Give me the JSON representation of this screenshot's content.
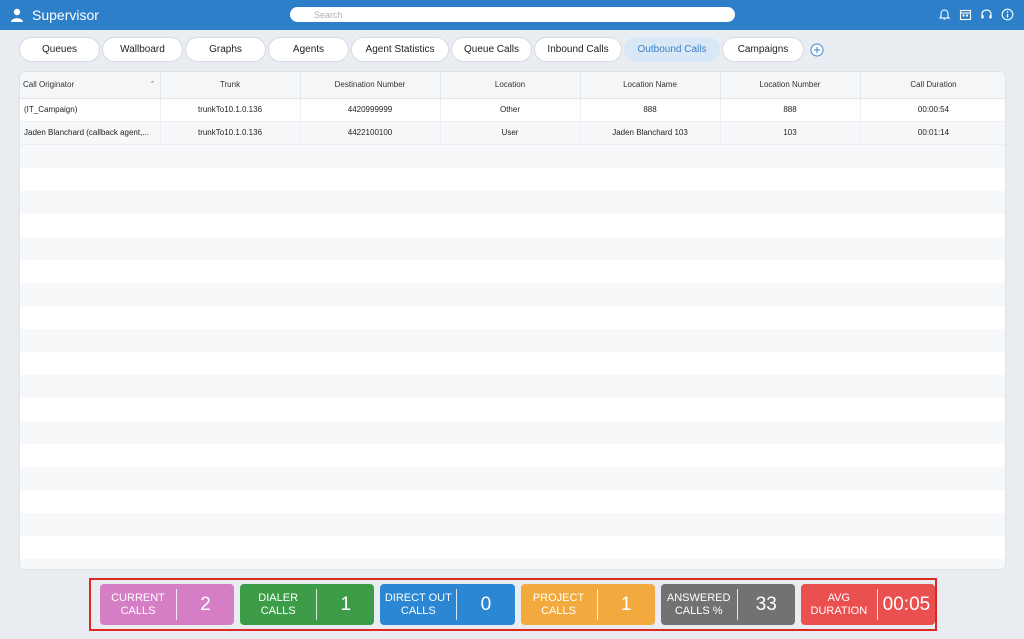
{
  "header": {
    "title": "Supervisor",
    "search_placeholder": "Search"
  },
  "header_icons": [
    "bell-icon",
    "calendar-icon",
    "headset-icon",
    "info-icon"
  ],
  "tabs": [
    {
      "label": "Queues"
    },
    {
      "label": "Wallboard"
    },
    {
      "label": "Graphs"
    },
    {
      "label": "Agents"
    },
    {
      "label": "Agent Statistics"
    },
    {
      "label": "Queue Calls"
    },
    {
      "label": "Inbound Calls"
    },
    {
      "label": "Outbound Calls"
    },
    {
      "label": "Campaigns"
    }
  ],
  "active_tab": "Outbound Calls",
  "table": {
    "columns": [
      "Call Originator",
      "Trunk",
      "Destination Number",
      "Location",
      "Location Name",
      "Location Number",
      "Call Duration"
    ],
    "sorted_column": "Call Originator",
    "rows": [
      [
        "(IT_Campaign)",
        "trunkTo10.1.0.136",
        "4420999999",
        "Other",
        "888",
        "888",
        "00:00:54"
      ],
      [
        "Jaden Blanchard (callback agent,...",
        "trunkTo10.1.0.136",
        "4422100100",
        "User",
        "Jaden Blanchard 103",
        "103",
        "00:01:14"
      ]
    ]
  },
  "stats": [
    {
      "label": "CURRENT CALLS",
      "value": "2",
      "color": "#d57ec5"
    },
    {
      "label": "DIALER CALLS",
      "value": "1",
      "color": "#3d9c48"
    },
    {
      "label": "DIRECT OUT CALLS",
      "value": "0",
      "color": "#2b87d3"
    },
    {
      "label": "PROJECT CALLS",
      "value": "1",
      "color": "#f2aa3f"
    },
    {
      "label": "ANSWERED CALLS %",
      "value": "33",
      "color": "#727272"
    },
    {
      "label": "AVG DURATION",
      "value": "00:05",
      "color": "#ea5050"
    }
  ],
  "colors": {
    "header": "#2d7fc9",
    "active_tab_bg": "#d8e8f7",
    "active_tab_text": "#3b7fc2",
    "highlight_border": "#dc2a22"
  }
}
